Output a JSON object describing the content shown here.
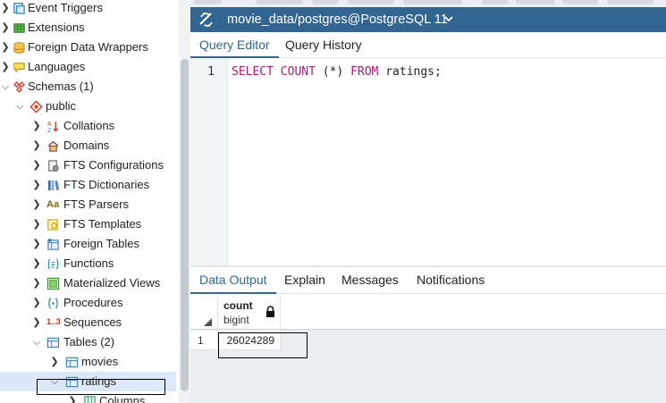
{
  "tree": {
    "items": [
      {
        "label": "Event Triggers",
        "icon": "event-trigger-icon"
      },
      {
        "label": "Extensions",
        "icon": "extension-icon"
      },
      {
        "label": "Foreign Data Wrappers",
        "icon": "foreign-data-wrapper-icon"
      },
      {
        "label": "Languages",
        "icon": "language-icon"
      },
      {
        "label": "Schemas (1)",
        "icon": "schemas-icon"
      },
      {
        "label": "public",
        "icon": "schema-icon"
      },
      {
        "label": "Collations",
        "icon": "collation-icon"
      },
      {
        "label": "Domains",
        "icon": "domain-icon"
      },
      {
        "label": "FTS Configurations",
        "icon": "fts-configuration-icon"
      },
      {
        "label": "FTS Dictionaries",
        "icon": "fts-dictionary-icon"
      },
      {
        "label": "FTS Parsers",
        "icon": "fts-parser-icon",
        "icon_text": "Aa"
      },
      {
        "label": "FTS Templates",
        "icon": "fts-template-icon"
      },
      {
        "label": "Foreign Tables",
        "icon": "foreign-table-icon"
      },
      {
        "label": "Functions",
        "icon": "function-icon"
      },
      {
        "label": "Materialized Views",
        "icon": "materialized-view-icon"
      },
      {
        "label": "Procedures",
        "icon": "procedure-icon"
      },
      {
        "label": "Sequences",
        "icon": "sequence-icon",
        "icon_text": "1..3"
      },
      {
        "label": "Tables (2)",
        "icon": "tables-icon"
      },
      {
        "label": "movies",
        "icon": "table-icon"
      },
      {
        "label": "ratings",
        "icon": "table-icon"
      },
      {
        "label": "Columns",
        "icon": "columns-icon"
      }
    ]
  },
  "title_bar": {
    "title": "movie_data/postgres@PostgreSQL 11"
  },
  "editor_tabs": {
    "query_editor": "Query Editor",
    "query_history": "Query History"
  },
  "editor": {
    "line_number": "1",
    "code": {
      "kw1": "SELECT",
      "kw2": "COUNT",
      "mid": " (*) ",
      "kw3": "FROM",
      "rest": " ratings;"
    }
  },
  "output_tabs": {
    "data_output": "Data Output",
    "explain": "Explain",
    "messages": "Messages",
    "notifications": "Notifications"
  },
  "grid": {
    "column": {
      "name": "count",
      "type": "bigint"
    },
    "rows": [
      {
        "row_number": "1",
        "value": "26024289"
      }
    ]
  },
  "colors": {
    "title_bar": "#326690",
    "keyword": "#a8187a",
    "selected_row": "#dce8f7"
  }
}
